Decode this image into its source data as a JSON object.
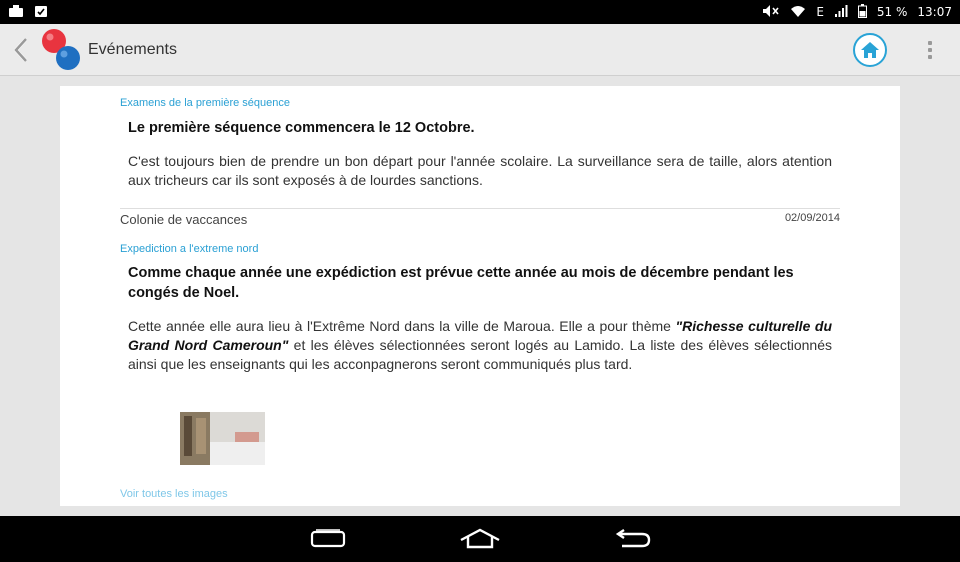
{
  "status_bar": {
    "network": "E",
    "battery": "51 %",
    "time": "13:07"
  },
  "app_bar": {
    "title": "Evénements"
  },
  "events": [
    {
      "subtitle": "Examens de la première séquence",
      "headline": "Le première séquence commencera le 12 Octobre.",
      "body": "C'est toujours bien de prendre un bon départ pour l'année scolaire. La surveillance sera de taille, alors atention aux tricheurs car ils sont exposés à de lourdes sanctions."
    },
    {
      "category": "Colonie de vaccances",
      "date": "02/09/2014",
      "subtitle": "Expediction a l'extreme nord",
      "headline": "Comme chaque année une expédiction est prévue cette année au mois de décembre pendant les congés de Noel.",
      "body_before": "Cette année elle aura lieu à l'Extrême Nord dans la ville de Maroua. Elle a pour thème ",
      "body_theme": "\"Richesse culturelle du Grand Nord Cameroun\"",
      "body_after": " et les élèves sélectionnées seront logés au Lamido. La liste des élèves sélectionnés ainsi que les enseignants qui les acconpagnerons seront communiqués plus tard.",
      "see_all_label": "Voir toutes les images"
    }
  ],
  "colors": {
    "accent": "#2aa0d4",
    "logo_red": "#e8343f",
    "logo_blue": "#1f6fc1"
  }
}
